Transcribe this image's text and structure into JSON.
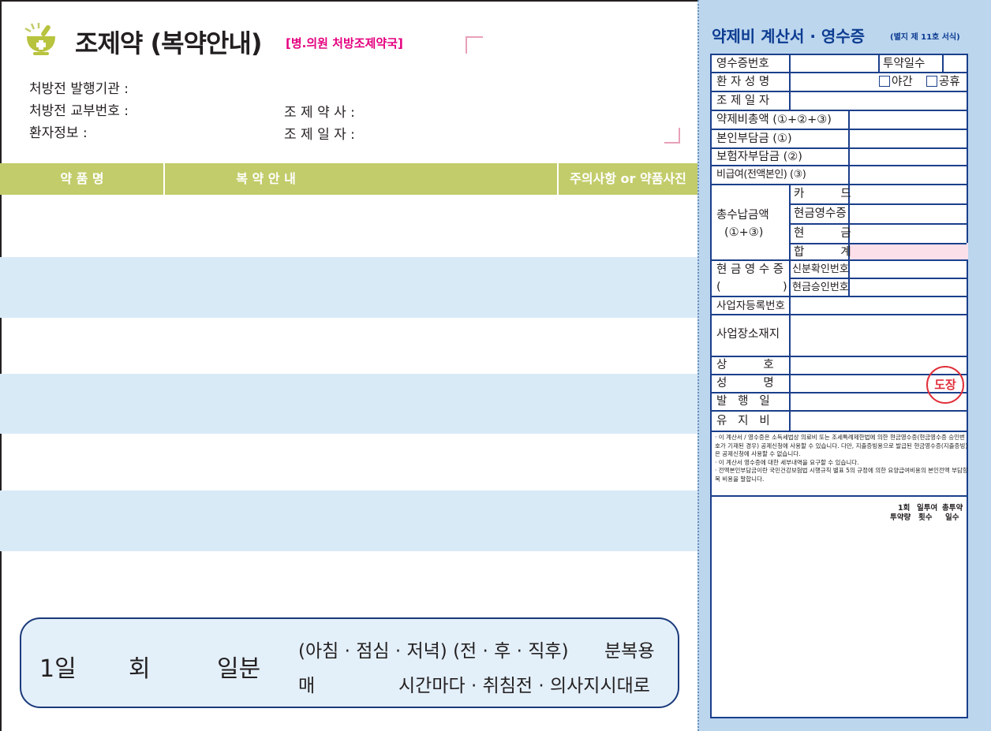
{
  "left": {
    "title": "조제약 (복약안내)",
    "subtitle": "[병.의원 처방조제약국]",
    "fields": {
      "issuer_label": "처방전 발행기관 :",
      "number_label": "처방전 교부번호 :",
      "patient_label": "환자정보 :",
      "pharmacist_label": "조 제 약 사 :",
      "date_label": "조 제 일 자 :"
    },
    "table_headers": [
      "약 품 명",
      "복 약 안 내",
      "주의사항 or 약품사진"
    ],
    "dose": {
      "day": "1일",
      "times": "회",
      "portion": "일분",
      "line1a": "(아침 · 점심 · 저녁) (전 · 후 · 직후)",
      "line1b": "분복용",
      "line2a": "매",
      "line2b": "시간마다 · 취침전 · 의사지시대로"
    }
  },
  "receipt": {
    "title": "약제비 계산서 · 영수증",
    "form": "(별지 제 11호 서식)",
    "rows": {
      "receipt_no": "영수증번호",
      "dosing_days": "투약일수",
      "patient_name": "환 자 성 명",
      "night": "야간",
      "holiday": "공휴",
      "dispense_date": "조 제 일 자",
      "total": "약제비총액 (①+②+③)",
      "self_pay": "본인부담금 (①)",
      "insurer_pay": "보험자부담금 (②)",
      "non_covered": "비급여(전액본인) (③)",
      "total_paid_1": "총수납금액",
      "total_paid_2": "(①+③)",
      "card": "카          드",
      "cash_receipt": "현금영수증",
      "cash": "현          금",
      "sum": "합          계",
      "cash_receipt_label": "현 금 영 수 증",
      "cash_receipt_paren_l": "(",
      "cash_receipt_paren_r": ")",
      "id_no": "신분확인번호",
      "approval_no": "현금승인번호",
      "biz_no": "사업자등록번호",
      "biz_address": "사업장소재지",
      "trade_name": "상          호",
      "name": "성          명",
      "issue_date": "발   행   일",
      "maintenance": "유   지   비",
      "stamp": "도장"
    },
    "notes": [
      "· 이 계산서 / 영수증은 소득세법상 의료비 또는 조세특례제한법에 의한 현금영수증(현금영수증 승인번호가 기재된 경우) 공제신청에 사용할 수 있습니다. 다만, 지출증빙용으로 발급된 현금영수증(지출증빙)은 공제신청에 사용할 수 없습니다.",
      "· 이 계산서 영수증에 대한 세부내역을 요구할 수 있습니다.",
      "· 전액본인부담금이란 국민건강보험법 시행규칙 별표 5의 규정에 의한 요양급여비용의 본인전액 부담항목 비용을 말합니다."
    ],
    "dose_cols": {
      "once": "1회",
      "daily": "일투여",
      "total": "총투약",
      "amount": "투약량",
      "count": "횟수",
      "days": "일수"
    }
  },
  "colors": {
    "header_green": "#c2cc6a",
    "stripe_blue": "#d9eaf7",
    "panel_blue": "#bcd6ee",
    "navy": "#1b3f8b",
    "magenta": "#e4007f",
    "stamp_red": "#e0303a",
    "sum_pink": "#fbe0ea"
  },
  "icons": [
    "mortar-pestle-icon"
  ]
}
